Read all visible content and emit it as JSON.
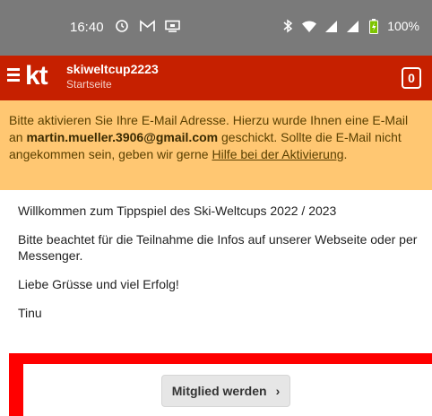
{
  "statusbar": {
    "time": "16:40",
    "battery": "100%",
    "icons": [
      "alarm-icon",
      "gmail-icon",
      "screen-icon",
      "bluetooth-icon",
      "wifi-icon",
      "signal-icon",
      "signal-icon",
      "battery-icon"
    ]
  },
  "header": {
    "logo": "kt",
    "title": "skiweltcup2223",
    "subtitle": "Startseite",
    "counter": "0"
  },
  "alert": {
    "text_1": "Bitte aktivieren Sie Ihre E-Mail Adresse. Hierzu wurde Ihnen eine E-Mail an ",
    "email": "martin.mueller.3906@gmail.com",
    "text_2": " geschickt. Sollte die E-Mail nicht angekommen sein, geben wir gerne ",
    "link": "Hilfe bei der Aktivierung",
    "text_3": "."
  },
  "content": {
    "welcome": "Willkommen zum Tippspiel des Ski-Weltcups 2022 / 2023",
    "info": "Bitte beachtet für die Teilnahme die Infos auf unserer Webseite oder per Messenger.",
    "greeting": "Liebe Grüsse und viel Erfolg!",
    "signature": "Tinu"
  },
  "cta": {
    "button_label": "Mitglied werden",
    "arrow": "›"
  },
  "colors": {
    "header": "#c62000",
    "alert": "#ffc772",
    "cta_border": "#ff0000",
    "statusbar": "#7a7a7a"
  }
}
